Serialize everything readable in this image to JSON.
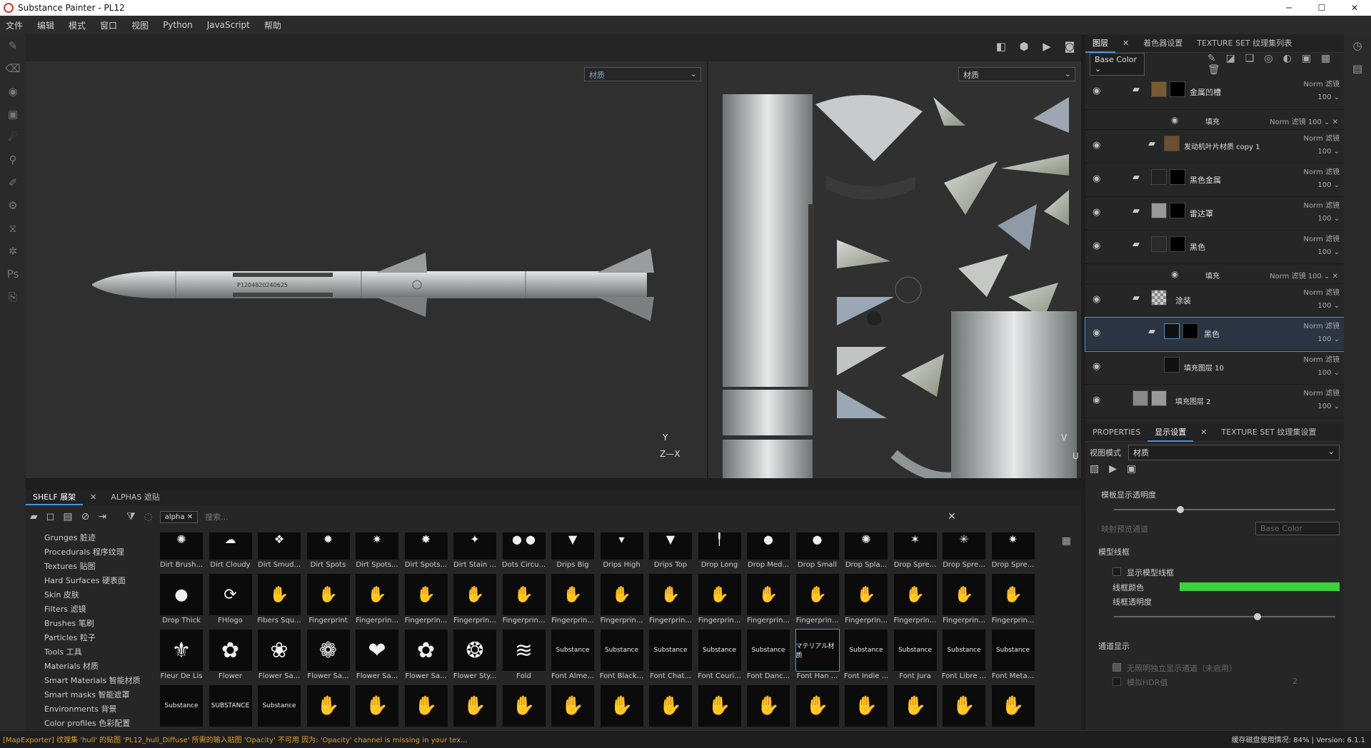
{
  "window": {
    "title": "Substance Painter - PL12",
    "buttons": [
      "─",
      "☐",
      "✕"
    ]
  },
  "menu": {
    "items": [
      "文件",
      "编辑",
      "模式",
      "窗口",
      "视图",
      "Python",
      "JavaScript",
      "帮助"
    ]
  },
  "viewport": {
    "material_select_left": "材质",
    "material_select_right": "材质",
    "missile_label": "P1204820240625",
    "axis_3d": "Z—X",
    "axis_3d_y": "Y",
    "axis_2d": "U",
    "axis_2d_y": "V"
  },
  "layers_panel": {
    "tabs": [
      "图层",
      "着色器设置",
      "TEXTURE SET 纹理集列表"
    ],
    "channel": "Base Color",
    "layers": [
      {
        "name": "金属凹槽",
        "blend": "Norm 滤镜",
        "opacity": "100"
      },
      {
        "name": "发动机叶片材质 copy 1",
        "blend": "Norm 滤镜",
        "opacity": "100"
      },
      {
        "name": "黑色金属",
        "blend": "Norm 滤镜",
        "opacity": "100"
      },
      {
        "name": "雷达罩",
        "blend": "Norm 滤镜",
        "opacity": "100"
      },
      {
        "name": "黑色",
        "blend": "Norm 滤镜",
        "opacity": "100"
      },
      {
        "name": "涂装",
        "blend": "Norm 滤镜",
        "opacity": "100"
      },
      {
        "name": "黑色",
        "blend": "Norm 滤镜",
        "opacity": "100"
      },
      {
        "name": "填充图层 10",
        "blend": "Norm 滤镜",
        "opacity": "100"
      },
      {
        "name": "填充图层 2",
        "blend": "Norm 滤镜",
        "opacity": "100"
      }
    ],
    "fill_label": "填充",
    "fill_blend": "Norm 滤镜",
    "fill_opacity": "100"
  },
  "display_panel": {
    "tabs": [
      "PROPERTIES",
      "显示设置",
      "TEXTURE SET 纹理集设置"
    ],
    "view_mode_label": "视图模式",
    "view_mode_value": "材质",
    "bg_opacity_label": "模板显示透明度",
    "preview_channel_label": "映射预览通道",
    "preview_channel_value": "Base Color",
    "wireframe_section": "模型线框",
    "show_wireframe": "显示模型线框",
    "wire_color_label": "线框颜色",
    "wire_color": "#3cd23c",
    "wire_opacity_label": "线框透明度",
    "channel_section": "通道显示",
    "channel_opt1": "无照明独立显示通道（未启用）",
    "channel_opt2": "模拟HDR值",
    "channel_value": "2"
  },
  "shelf": {
    "tabs": [
      "SHELF 展架",
      "ALPHAS 遮贴"
    ],
    "filter_tag": "alpha",
    "search_placeholder": "搜索...",
    "categories": [
      "Grunges 脏迹",
      "Procedurals 程序纹理",
      "Textures 贴图",
      "Hard Surfaces 硬表面",
      "Skin 皮肤",
      "Filters 滤镜",
      "Brushes 笔刷",
      "Particles 粒子",
      "Tools 工具",
      "Materials 材质",
      "Smart Materials 智能材质",
      "Smart masks 智能遮罩",
      "Environments 背景",
      "Color profiles 色彩配置"
    ],
    "rows": [
      [
        "Dirt Brush...",
        "Dirt Cloudy",
        "Dirt Smud...",
        "Dirt Spots",
        "Dirt Spots...",
        "Dirt Spots...",
        "Dirt Stain ...",
        "Dots Circu...",
        "Drips Big",
        "Drips High",
        "Drips Top",
        "Drop Long",
        "Drop Med...",
        "Drop Small",
        "Drop Spla...",
        "Drop Spre...",
        "Drop Spre...",
        "Drop Spre..."
      ],
      [
        "Drop Thick",
        "FHlogo",
        "Fibers Squ...",
        "Fingerprint",
        "Fingerprin...",
        "Fingerprin...",
        "Fingerprin...",
        "Fingerprin...",
        "Fingerprin...",
        "Fingerprin...",
        "Fingerprin...",
        "Fingerprin...",
        "Fingerprin...",
        "Fingerprin...",
        "Fingerprin...",
        "Fingerprin...",
        "Fingerprin...",
        "Fingerprin..."
      ],
      [
        "Fleur De Lis",
        "Flower",
        "Flower Sa...",
        "Flower Sa...",
        "Flower Sa...",
        "Flower Sa...",
        "Flower Sty...",
        "Fold",
        "Font Alme...",
        "Font Black...",
        "Font Chat...",
        "Font Couri...",
        "Font Danc...",
        "Font Han ...",
        "Font Indie ...",
        "Font Jura",
        "Font Libre ...",
        "Font Meta..."
      ],
      [
        "",
        "",
        "",
        "",
        "",
        "",
        "",
        "",
        "",
        "",
        "",
        "",
        "",
        "",
        "",
        "",
        "",
        ""
      ]
    ],
    "font_previews": [
      "Substance",
      "Substance",
      "Substance",
      "Substance",
      "Substance",
      "マテリアル材质",
      "Substance",
      "Substance",
      "Substance",
      "Substance"
    ],
    "bottom_previews": [
      "Substance",
      "SUBSTANCE",
      "Substance"
    ]
  },
  "status": {
    "message": "[MapExporter] 纹理集 'hull' 的贴图 'PL12_hull_Diffuse' 所需的输入贴图 'Opacity' 不可用 因为: 'Opacity' channel is missing in your tex...",
    "cache": "缓存磁盘使用情况:",
    "cache_value": "84%",
    "version": "Version: 6.1.1"
  }
}
